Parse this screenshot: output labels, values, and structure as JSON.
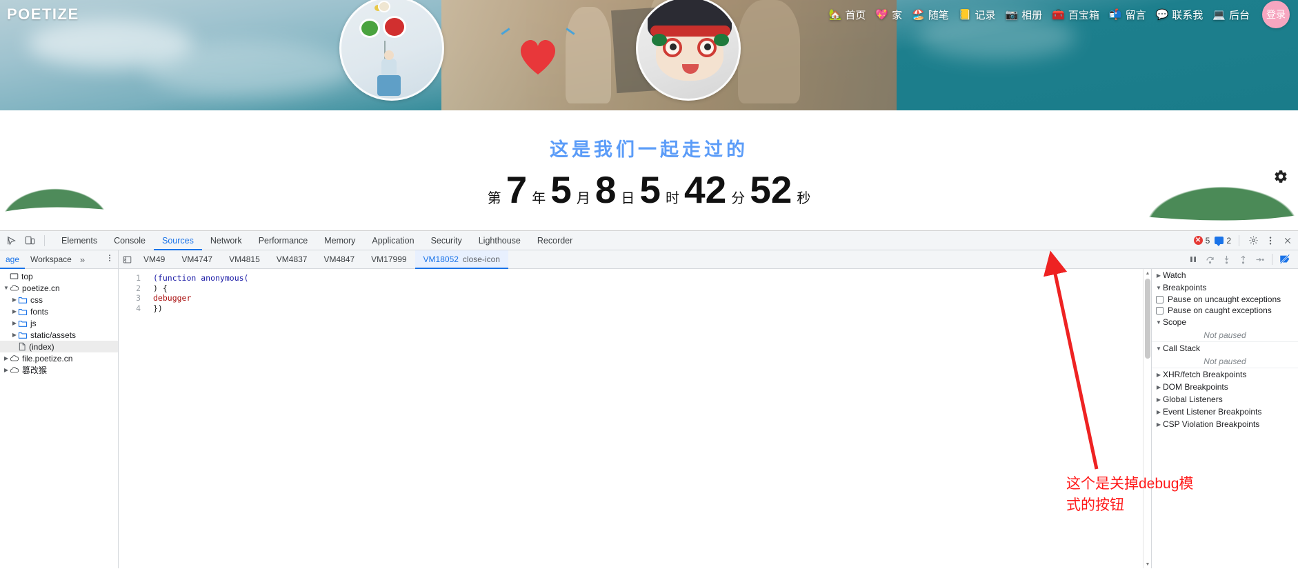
{
  "site": {
    "logo": "POETIZE",
    "nav_items": [
      {
        "emoji": "🏡",
        "label": "首页",
        "name": "nav-home"
      },
      {
        "emoji": "💖",
        "label": "家",
        "name": "nav-family"
      },
      {
        "emoji": "🏖️",
        "label": "随笔",
        "name": "nav-essay"
      },
      {
        "emoji": "📒",
        "label": "记录",
        "name": "nav-record"
      },
      {
        "emoji": "📷",
        "label": "相册",
        "name": "nav-album"
      },
      {
        "emoji": "🧰",
        "label": "百宝箱",
        "name": "nav-toolbox"
      },
      {
        "emoji": "📬",
        "label": "留言",
        "name": "nav-message"
      },
      {
        "emoji": "💬",
        "label": "联系我",
        "name": "nav-contact"
      },
      {
        "emoji": "💻",
        "label": "后台",
        "name": "nav-admin"
      }
    ],
    "login_label": "登录",
    "countdown": {
      "title": "这是我们一起走过的",
      "prefix": "第",
      "segments": [
        {
          "value": "7",
          "unit": "年"
        },
        {
          "value": "5",
          "unit": "月"
        },
        {
          "value": "8",
          "unit": "日"
        },
        {
          "value": "5",
          "unit": "时"
        },
        {
          "value": "42",
          "unit": "分"
        },
        {
          "value": "52",
          "unit": "秒"
        }
      ]
    },
    "gear_icon": "gear-icon"
  },
  "devtools": {
    "tabs": [
      {
        "label": "Elements",
        "active": false
      },
      {
        "label": "Console",
        "active": false
      },
      {
        "label": "Sources",
        "active": true
      },
      {
        "label": "Network",
        "active": false
      },
      {
        "label": "Performance",
        "active": false
      },
      {
        "label": "Memory",
        "active": false
      },
      {
        "label": "Application",
        "active": false
      },
      {
        "label": "Security",
        "active": false
      },
      {
        "label": "Lighthouse",
        "active": false
      },
      {
        "label": "Recorder",
        "active": false
      }
    ],
    "error_count": "5",
    "warning_count": "2",
    "settings_icon": "gear-icon",
    "more_icon": "kebab-menu-icon",
    "close_icon": "close-icon",
    "nav_pane_tabs": [
      {
        "label": "age",
        "active": true
      },
      {
        "label": "Workspace",
        "active": false
      }
    ],
    "nav_pane_more": "»",
    "vm_tabs": [
      {
        "label": "VM49",
        "active": false
      },
      {
        "label": "VM4747",
        "active": false
      },
      {
        "label": "VM4815",
        "active": false
      },
      {
        "label": "VM4837",
        "active": false
      },
      {
        "label": "VM4847",
        "active": false
      },
      {
        "label": "VM17999",
        "active": false
      },
      {
        "label": "VM18052",
        "active": true
      }
    ],
    "debug_controls": [
      {
        "name": "resume-script-execution-button",
        "icon": "pause-icon"
      },
      {
        "name": "step-over-button",
        "icon": "step-over-icon"
      },
      {
        "name": "step-into-button",
        "icon": "step-into-icon"
      },
      {
        "name": "step-out-button",
        "icon": "step-out-icon"
      },
      {
        "name": "step-button",
        "icon": "step-icon"
      },
      {
        "name": "deactivate-breakpoints-button",
        "icon": "deactivate-breakpoints-icon"
      }
    ],
    "file_tree": [
      {
        "label": "top",
        "indent": 0,
        "twisty": "",
        "icon": "frame-icon"
      },
      {
        "label": "poetize.cn",
        "indent": 0,
        "twisty": "▼",
        "icon": "cloud-icon"
      },
      {
        "label": "css",
        "indent": 1,
        "twisty": "▶",
        "icon": "folder-icon"
      },
      {
        "label": "fonts",
        "indent": 1,
        "twisty": "▶",
        "icon": "folder-icon"
      },
      {
        "label": "js",
        "indent": 1,
        "twisty": "▶",
        "icon": "folder-icon"
      },
      {
        "label": "static/assets",
        "indent": 1,
        "twisty": "▶",
        "icon": "folder-icon"
      },
      {
        "label": "(index)",
        "indent": 1,
        "twisty": "",
        "icon": "file-icon",
        "selected": true
      },
      {
        "label": "file.poetize.cn",
        "indent": 0,
        "twisty": "▶",
        "icon": "cloud-icon"
      },
      {
        "label": "篡改猴",
        "indent": 0,
        "twisty": "▶",
        "icon": "cloud-icon"
      }
    ],
    "code_lines": [
      {
        "num": "1",
        "text": "(function anonymous("
      },
      {
        "num": "2",
        "text": ") {"
      },
      {
        "num": "3",
        "text": "debugger"
      },
      {
        "num": "4",
        "text": "})"
      }
    ],
    "debug_panel": {
      "watch": "Watch",
      "breakpoints": "Breakpoints",
      "pause_uncaught": "Pause on uncaught exceptions",
      "pause_caught": "Pause on caught exceptions",
      "scope": "Scope",
      "scope_value": "Not paused",
      "call_stack": "Call Stack",
      "call_stack_value": "Not paused",
      "sections": [
        "XHR/fetch Breakpoints",
        "DOM Breakpoints",
        "Global Listeners",
        "Event Listener Breakpoints",
        "CSP Violation Breakpoints"
      ]
    }
  },
  "annotation": {
    "text_line1": "这个是关掉debug模",
    "text_line2": "式的按钮",
    "color": "#ff1a1a"
  }
}
